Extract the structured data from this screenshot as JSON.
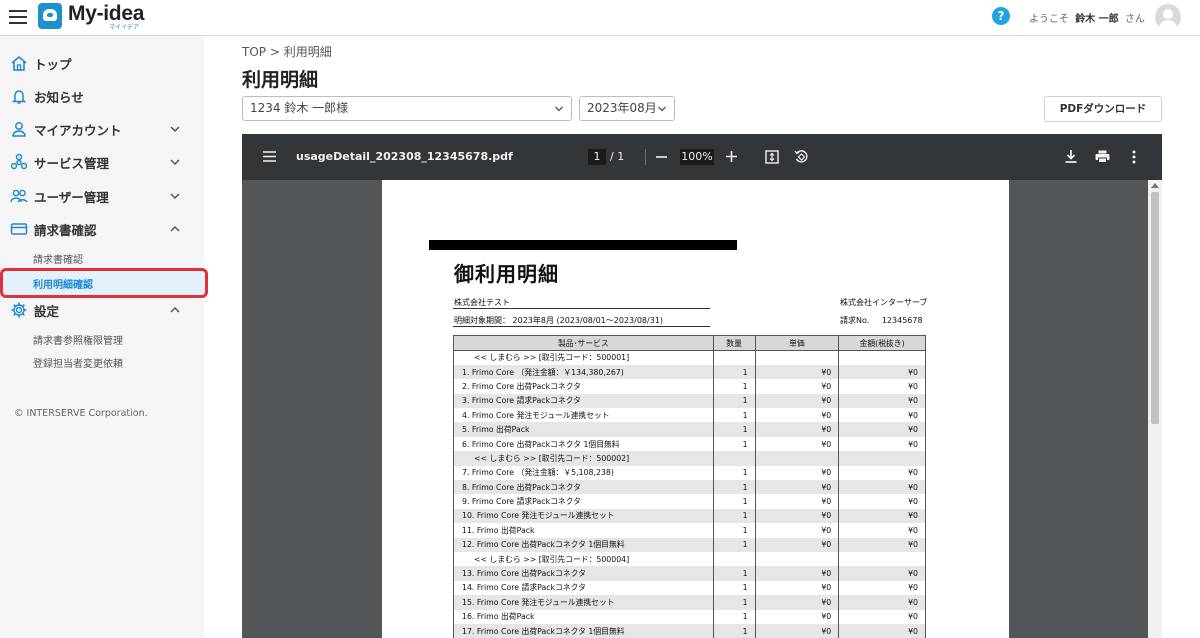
{
  "header": {
    "logo_text": "My-idea",
    "logo_sub": "マイイデア",
    "help_label": "?",
    "welcome_prefix": "ようこそ",
    "user_name": "鈴木 一郎",
    "welcome_suffix": "さん"
  },
  "sidebar": {
    "items": [
      {
        "label": "トップ",
        "icon": "home-icon"
      },
      {
        "label": "お知らせ",
        "icon": "bell-icon"
      },
      {
        "label": "マイアカウント",
        "icon": "user-icon"
      },
      {
        "label": "サービス管理",
        "icon": "service-icon"
      },
      {
        "label": "ユーザー管理",
        "icon": "users-icon"
      },
      {
        "label": "請求書確認",
        "icon": "card-icon"
      },
      {
        "label": "設定",
        "icon": "gear-icon"
      }
    ],
    "billing_sub": [
      "請求書確認",
      "利用明細確認"
    ],
    "settings_sub": [
      "請求書参照権限管理",
      "登録担当者変更依頼"
    ],
    "copyright": "© INTERSERVE Corporation."
  },
  "main": {
    "breadcrumb": "TOP > 利用明細",
    "title": "利用明細",
    "account_select": "1234 鈴木 一郎様",
    "month_select": "2023年08月",
    "pdf_button": "PDFダウンロード"
  },
  "viewer": {
    "filename": "usageDetail_202308_12345678.pdf",
    "current_page": "1",
    "total_pages": "/ 1",
    "zoom": "100%"
  },
  "document": {
    "title": "御利用明細",
    "customer": "株式会社テスト",
    "period": "明細対象期間： 2023年8月 (2023/08/01〜2023/08/31)",
    "issuer": "株式会社インターサーブ",
    "invoice_no_label": "請求No.",
    "invoice_no": "12345678",
    "columns": [
      "製品･サービス",
      "数量",
      "単価",
      "金額(税抜き)"
    ],
    "rows": [
      {
        "group": true,
        "name": "<< しまむら >> [取引先コード：500001]"
      },
      {
        "name": "1. Frimo Core （発注金額：￥134,380,267)",
        "qty": "1",
        "price": "¥0",
        "amount": "¥0"
      },
      {
        "name": "2. Frimo Core 出荷Packコネクタ",
        "qty": "1",
        "price": "¥0",
        "amount": "¥0"
      },
      {
        "name": "3. Frimo Core 請求Packコネクタ",
        "qty": "1",
        "price": "¥0",
        "amount": "¥0"
      },
      {
        "name": "4. Frimo Core 発注モジュール連携セット",
        "qty": "1",
        "price": "¥0",
        "amount": "¥0"
      },
      {
        "name": "5. Frimo 出荷Pack",
        "qty": "1",
        "price": "¥0",
        "amount": "¥0"
      },
      {
        "name": "6. Frimo Core 出荷Packコネクタ 1個目無料",
        "qty": "1",
        "price": "¥0",
        "amount": "¥0"
      },
      {
        "group": true,
        "name": "<< しまむら >> [取引先コード：500002]"
      },
      {
        "name": "7. Frimo Core （発注金額：￥5,108,238)",
        "qty": "1",
        "price": "¥0",
        "amount": "¥0"
      },
      {
        "name": "8. Frimo Core 出荷Packコネクタ",
        "qty": "1",
        "price": "¥0",
        "amount": "¥0"
      },
      {
        "name": "9. Frimo Core 請求Packコネクタ",
        "qty": "1",
        "price": "¥0",
        "amount": "¥0"
      },
      {
        "name": "10. Frimo Core 発注モジュール連携セット",
        "qty": "1",
        "price": "¥0",
        "amount": "¥0"
      },
      {
        "name": "11. Frimo 出荷Pack",
        "qty": "1",
        "price": "¥0",
        "amount": "¥0"
      },
      {
        "name": "12. Frimo Core 出荷Packコネクタ 1個目無料",
        "qty": "1",
        "price": "¥0",
        "amount": "¥0"
      },
      {
        "group": true,
        "name": "<< しまむら >> [取引先コード：500004]"
      },
      {
        "name": "13. Frimo Core 出荷Packコネクタ",
        "qty": "1",
        "price": "¥0",
        "amount": "¥0"
      },
      {
        "name": "14. Frimo Core 請求Packコネクタ",
        "qty": "1",
        "price": "¥0",
        "amount": "¥0"
      },
      {
        "name": "15. Frimo Core 発注モジュール連携セット",
        "qty": "1",
        "price": "¥0",
        "amount": "¥0"
      },
      {
        "name": "16. Frimo 出荷Pack",
        "qty": "1",
        "price": "¥0",
        "amount": "¥0"
      },
      {
        "name": "17. Frimo Core 出荷Packコネクタ 1個目無料",
        "qty": "1",
        "price": "¥0",
        "amount": "¥0"
      }
    ]
  },
  "colors": {
    "accent": "#1e88d0",
    "highlight_border": "#e0303c",
    "viewer_toolbar": "#323639",
    "viewer_bg": "#525659"
  }
}
